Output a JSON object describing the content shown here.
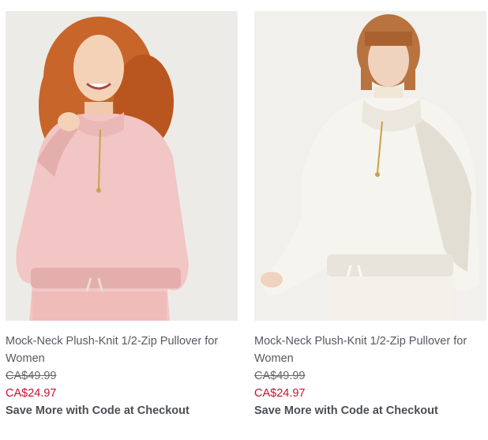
{
  "products": [
    {
      "title": "Mock-Neck Plush-Knit 1/2-Zip Pullover for Women",
      "original_price": "CA$49.99",
      "sale_price": "CA$24.97",
      "promo": "Save More with Code at Checkout",
      "colors": {
        "background": "#ecebe7",
        "garment": "#f2c6c4",
        "garment_shade": "#e3aeac",
        "hair": "#c8652a"
      }
    },
    {
      "title": "Mock-Neck Plush-Knit 1/2-Zip Pullover for Women",
      "original_price": "CA$49.99",
      "sale_price": "CA$24.97",
      "promo": "Save More with Code at Checkout",
      "colors": {
        "background": "#f1f0ec",
        "garment": "#f6f4ee",
        "garment_shade": "#e2ded4",
        "hair": "#b8733f"
      }
    }
  ],
  "colors": {
    "sale_price": "#c8102e",
    "title_text": "#555a60"
  }
}
